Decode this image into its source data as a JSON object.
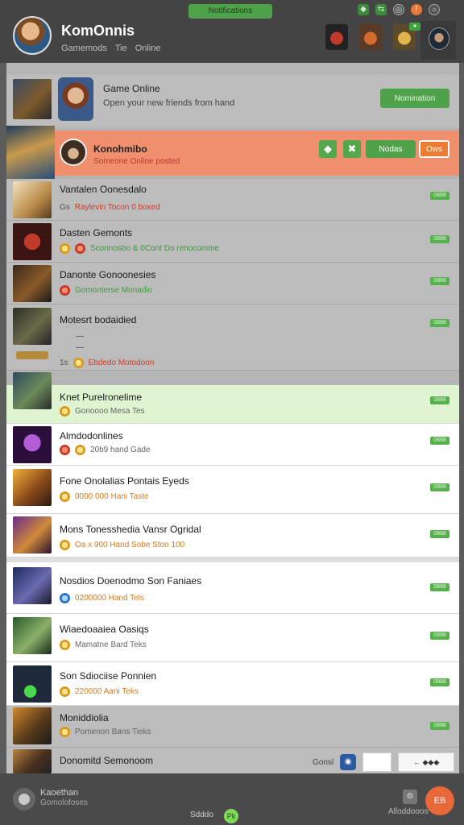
{
  "header": {
    "top_pill": "Notifications",
    "system_icons": [
      "◆",
      "⇆",
      "◎",
      "!",
      "○"
    ],
    "profile_name": "KomOnnis",
    "profile_tabs": [
      "Gamemods",
      "Tie",
      "Online"
    ]
  },
  "banner": {
    "title": "Game Online",
    "subtitle": "Open your new friends from hand",
    "button": "Nomination"
  },
  "active": {
    "title": "Konohmibo",
    "subtitle": "Someone Online posted",
    "accept_label": "Nodas",
    "decline_label": "Ows"
  },
  "rows": [
    {
      "title": "Vantalen Oonesdalo",
      "sub_a": "Gs",
      "sub_b": "Raylevin Tocon 0 boxed"
    },
    {
      "title": "Dasten Gemonts",
      "sub_a": "",
      "sub_b": "Sconnosbo & 0Cont Do renocomme"
    },
    {
      "title": "Danonte Gonoonesies",
      "sub_a": "",
      "sub_b": "Gomonterse Monadio"
    },
    {
      "title": "Motesrt bodaidied",
      "sub_a": "1s",
      "sub_b": "Ebdedo Motodoon"
    },
    {
      "title": "Knet Purelronelime",
      "sub_a": "",
      "sub_b": "Gonoooo Mesa Tes"
    },
    {
      "title": "Almdodonlines",
      "sub_a": "",
      "sub_b": "20b9 hand Gade"
    },
    {
      "title": "Fone Onolalias Pontais Eyeds",
      "sub_a": "",
      "sub_b": "0000 000 Hani Taste"
    },
    {
      "title": "Mons Tonesshedia Vansr Ogridal",
      "sub_a": "",
      "sub_b": "Oa x 900 Hand Sobe Stoo 100"
    },
    {
      "title": "Nosdios Doenodmo Son Faniaes",
      "sub_a": "",
      "sub_b": "0200000 Hand Tels"
    },
    {
      "title": "Wiaedoaaiea Oasiqs",
      "sub_a": "",
      "sub_b": "Mamatne Bard Teks"
    },
    {
      "title": "Son Sdiociise Ponnien",
      "sub_a": "",
      "sub_b": "220000 Aani Teks"
    },
    {
      "title": "Moniddiolia",
      "sub_a": "",
      "sub_b": "Pomenon Bans Tieks"
    },
    {
      "title": "Donomitd Semonoom",
      "sub_a": "",
      "sub_b": ""
    }
  ],
  "row_tag": "0888",
  "bottom_controls": {
    "label": "Gonsl",
    "light_text": "← ◆◆◆"
  },
  "footer": {
    "name": "Kaoethan",
    "sub": "Gomolofoses",
    "center_text": "Sdddo",
    "badge": "Pk",
    "icon_label": "Alloddooos",
    "fab": "EB"
  },
  "colors": {
    "accent": "#4fa24a",
    "active_row": "#ef8f6e",
    "highlight_row": "#dff5d2",
    "fab": "#e8683a"
  }
}
